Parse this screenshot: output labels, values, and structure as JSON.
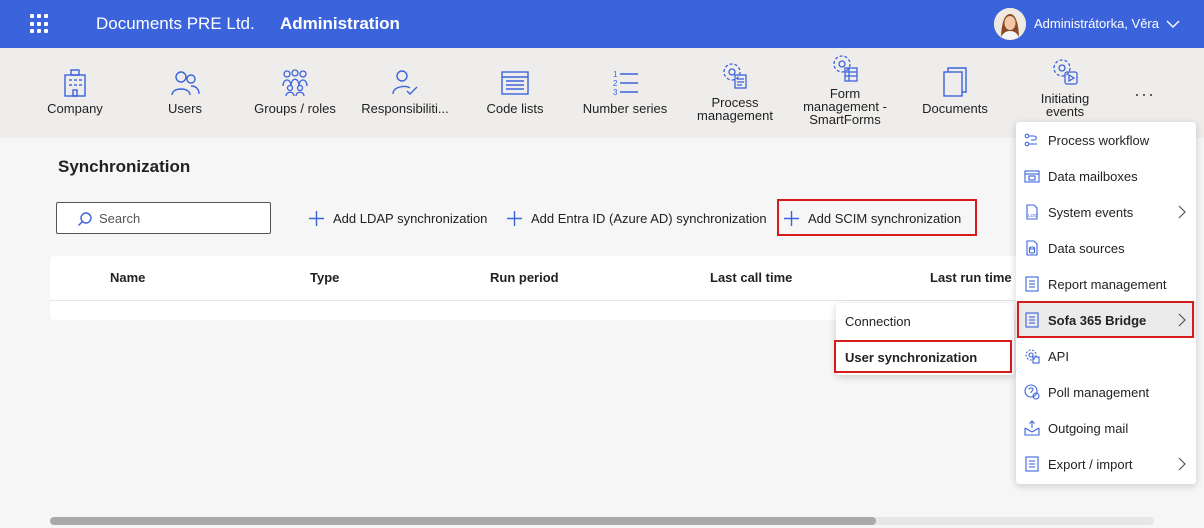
{
  "header": {
    "company": "Documents PRE Ltd.",
    "title": "Administration",
    "user": "Administrátorka, Věra"
  },
  "toolbar": {
    "items": [
      {
        "label": "Company",
        "icon": "building-icon"
      },
      {
        "label": "Users",
        "icon": "users-icon"
      },
      {
        "label": "Groups / roles",
        "icon": "groups-icon"
      },
      {
        "label": "Responsibiliti...",
        "icon": "user-check-icon"
      },
      {
        "label": "Code lists",
        "icon": "code-list-icon"
      },
      {
        "label": "Number series",
        "icon": "number-series-icon"
      },
      {
        "label1": "Process",
        "label2": "management",
        "icon": "gear-doc-icon"
      },
      {
        "label1": "Form",
        "label2": "management -",
        "label3": "SmartForms",
        "icon": "gear-table-icon"
      },
      {
        "label": "Documents",
        "icon": "documents-icon"
      },
      {
        "label1": "Initiating",
        "label2": "events",
        "icon": "gear-play-icon"
      }
    ],
    "more": "···"
  },
  "main": {
    "title": "Synchronization",
    "search_placeholder": "Search",
    "actions": {
      "ldap": "Add LDAP synchronization",
      "entra": "Add Entra ID (Azure AD) synchronization",
      "scim": "Add SCIM synchronization"
    },
    "columns": [
      "Name",
      "Type",
      "Run period",
      "Last call time",
      "Last run time"
    ]
  },
  "dropdown": {
    "items": [
      {
        "label": "Process workflow",
        "icon": "workflow-icon"
      },
      {
        "label": "Data mailboxes",
        "icon": "mailbox-icon"
      },
      {
        "label": "System events",
        "icon": "log-icon",
        "submenu": true
      },
      {
        "label": "Data sources",
        "icon": "datasource-icon"
      },
      {
        "label": "Report management",
        "icon": "report-icon"
      },
      {
        "label": "Sofa 365 Bridge",
        "icon": "bridge-icon",
        "submenu": true,
        "active": true
      },
      {
        "label": "API",
        "icon": "api-icon"
      },
      {
        "label": "Poll management",
        "icon": "poll-icon"
      },
      {
        "label": "Outgoing mail",
        "icon": "outgoing-mail-icon"
      },
      {
        "label": "Export / import",
        "icon": "export-icon",
        "submenu": true
      }
    ]
  },
  "submenu": {
    "items": [
      "Connection",
      "User synchronization"
    ]
  },
  "colors": {
    "brand": "#3b63dc",
    "highlight": "#d61b1b",
    "toolbar_bg": "#efedeb"
  }
}
